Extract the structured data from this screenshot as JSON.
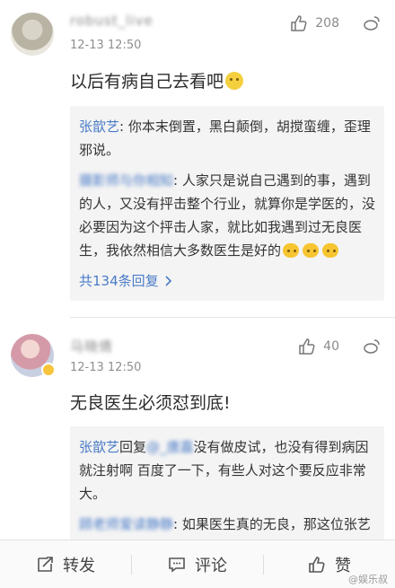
{
  "comments": [
    {
      "username": "robust_live",
      "time": "12-13 12:50",
      "likes": "208",
      "text": "以后有病自己去看吧",
      "replies": [
        {
          "name": "张歆艺",
          "name_blurred": false,
          "text": ": 你本末倒置，黑白颠倒，胡搅蛮缠，歪理邪说。"
        },
        {
          "name": "摄影师与你相知",
          "name_blurred": true,
          "text": ": 人家只是说自己遇到的事，遇到的人，又没有抨击整个行业，就算你是学医的，没必要因为这个抨击人家，就比如我遇到过无良医生，我依然相信大多数医生是好的"
        }
      ],
      "more_replies": "共134条回复"
    },
    {
      "username": "马晓倩",
      "time": "12-13 12:50",
      "likes": "40",
      "text": "无良医生必须怼到底!",
      "replies": [
        {
          "name": "张歆艺",
          "name_blurred": false,
          "prefix": "回复",
          "mention": "@_唐嘉",
          "text": "没有做皮试，也没有得到病因就注射啊 百度了一下，有些人对这个要反应非常大。"
        },
        {
          "name": "顾老师爱读静静",
          "name_blurred": true,
          "text": ": 如果医生真的无良，那这位张艺人恐怕就没时间在这里跟你们发那些调"
        }
      ]
    }
  ],
  "toolbar": {
    "repost": "转发",
    "comment": "评论",
    "like": "赞"
  },
  "watermark": "@娱乐叔",
  "colors": {
    "link": "#4a7bc7",
    "badge": "#f7c43b"
  }
}
